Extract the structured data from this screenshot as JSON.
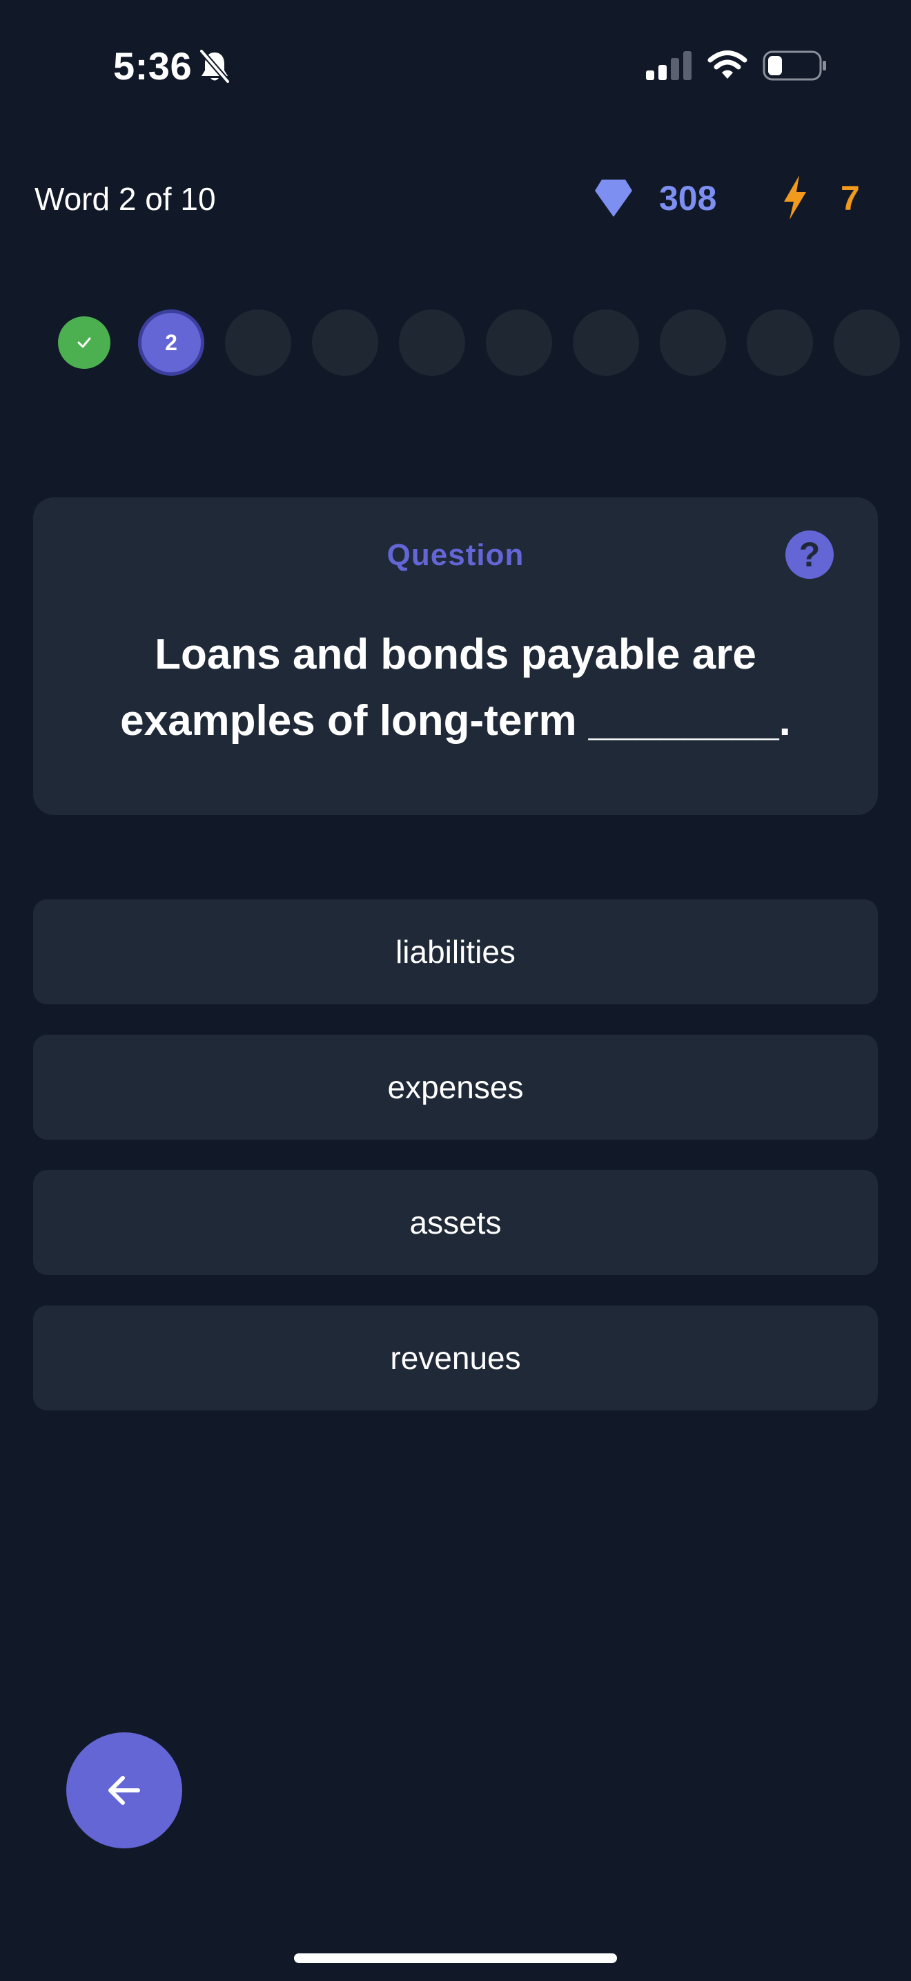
{
  "status_bar": {
    "time": "5:36",
    "icons": [
      "bell-slash-icon",
      "cellular-signal-icon",
      "wifi-icon",
      "battery-icon"
    ]
  },
  "header": {
    "progress_text": "Word 2 of 10",
    "gems": "308",
    "streak": "7",
    "gem_icon": "gem-icon",
    "streak_icon": "lightning-bolt-icon",
    "colors": {
      "gems": "#7d8ff0",
      "streak": "#f29a1d"
    }
  },
  "steps": [
    {
      "state": "done",
      "label": ""
    },
    {
      "state": "current",
      "label": "2"
    },
    {
      "state": "upcoming",
      "label": ""
    },
    {
      "state": "upcoming",
      "label": ""
    },
    {
      "state": "upcoming",
      "label": ""
    },
    {
      "state": "upcoming",
      "label": ""
    },
    {
      "state": "upcoming",
      "label": ""
    },
    {
      "state": "upcoming",
      "label": ""
    },
    {
      "state": "upcoming",
      "label": ""
    },
    {
      "state": "upcoming",
      "label": ""
    }
  ],
  "question": {
    "label": "Question",
    "help_symbol": "?",
    "text": "Loans and bonds payable are examples of long-term ________."
  },
  "options": [
    "liabilities",
    "expenses",
    "assets",
    "revenues"
  ],
  "back_button": {
    "icon": "arrow-left-icon"
  },
  "colors": {
    "background": "#111827",
    "card": "#1f2937",
    "accent": "#6366d4",
    "done": "#4caf50"
  }
}
